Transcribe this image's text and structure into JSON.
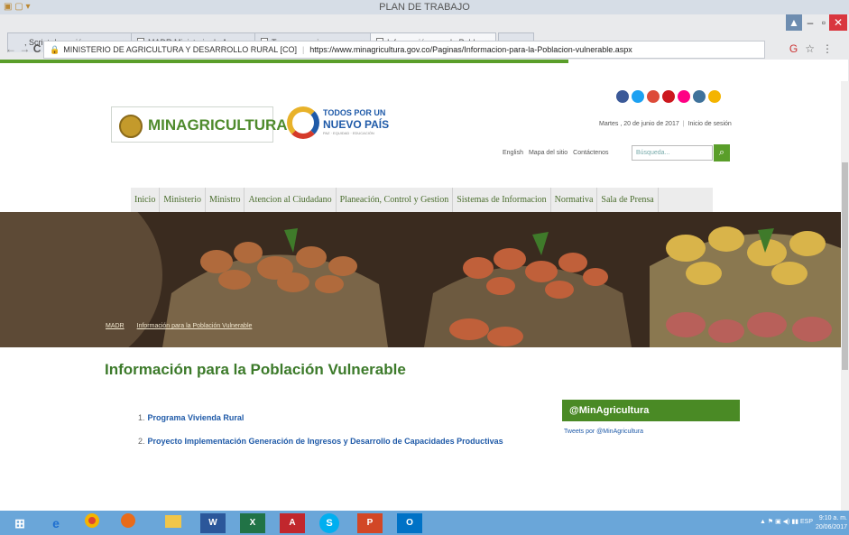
{
  "window": {
    "title": "PLAN DE TRABAJO"
  },
  "browser": {
    "tabs": [
      {
        "label": ", Script de sesión"
      },
      {
        "label": "MADR Ministerio de Agr"
      },
      {
        "label": "Transparencia"
      },
      {
        "label": "Información para la Pobl"
      }
    ],
    "address": {
      "site_label": "MINISTERIO DE AGRICULTURA Y DESARROLLO RURAL [CO]",
      "url": "https://www.minagricultura.gov.co/Paginas/Informacion-para-la-Poblacion-vulnerable.aspx"
    }
  },
  "header": {
    "logo_text": "MINAGRICULTURA",
    "logo2_line1": "TODOS POR UN",
    "logo2_line2": "NUEVO PAÍS",
    "logo2_line3": "PAZ · EQUIDAD · EDUCACIÓN",
    "date_text": "Martes , 20 de junio de 2017",
    "login": "Inicio de sesión",
    "top_links": [
      "English",
      "Mapa del sitio",
      "Contáctenos"
    ],
    "search_placeholder": "Búsqueda...",
    "social_colors": [
      "#3b5998",
      "#1da1f2",
      "#dd4b39",
      "#cc181e",
      "#ff0084",
      "#3f729b",
      "#f4b400"
    ]
  },
  "nav": {
    "items": [
      "Inicio",
      "Ministerio",
      "Ministro",
      "Atencion al Ciudadano",
      "Planeación, Control y Gestion",
      "Sistemas de Informacion",
      "Normativa",
      "Sala de Prensa"
    ]
  },
  "breadcrumb": [
    "MADR",
    "Información para la Población Vulnerable"
  ],
  "main": {
    "title": "Información para la Población Vulnerable",
    "items": [
      {
        "num": "1.",
        "label": "Programa Vivienda Rural"
      },
      {
        "num": "2.",
        "label": "Proyecto Implementación Generación de Ingresos y Desarrollo de Capacidades Productivas"
      }
    ]
  },
  "twitter": {
    "heading": "@MinAgricultura",
    "link": "Tweets por @MinAgricultura"
  },
  "taskbar": {
    "apps": [
      "windows-start",
      "internet-explorer",
      "chrome",
      "firefox",
      "file-explorer",
      "word",
      "excel",
      "acrobat",
      "skype",
      "powerpoint",
      "outlook"
    ],
    "lang": "ESP",
    "time": "9:10 a. m.",
    "date": "20/06/2017"
  }
}
